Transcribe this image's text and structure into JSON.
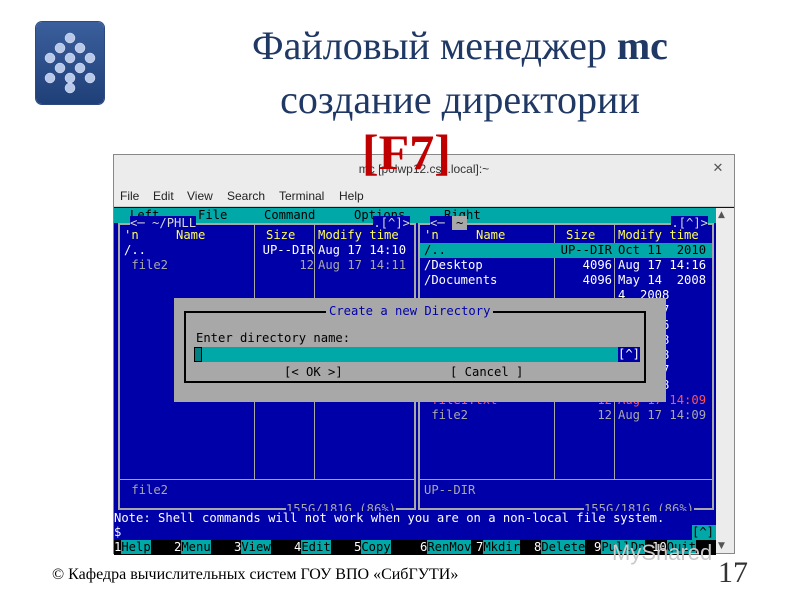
{
  "slide": {
    "title_line1_prefix": "Файловый менеджер ",
    "title_line1_bold": "mc",
    "title_line2": "создание директории",
    "hotkey": "[F7]",
    "footer": "© Кафедра вычислительных систем ГОУ ВПО «СибГУТИ»",
    "page_number": "17",
    "watermark": "MyShared"
  },
  "window": {
    "title": "mc [polwp12.csc.local]:~",
    "close_glyph": "✕",
    "menu": [
      "File",
      "Edit",
      "View",
      "Search",
      "Terminal",
      "Help"
    ]
  },
  "mc_menu": [
    "Left",
    "File",
    "Command",
    "Options",
    "Right"
  ],
  "left_panel": {
    "title": "~/PHLL",
    "corner": ".[^]>",
    "col_n": "'n",
    "col_name": "Name",
    "col_size": "Size",
    "col_mtime": "Modify time",
    "rows": [
      {
        "name": "/..",
        "size": "UP--DIR",
        "mtime": "Aug 17 14:10",
        "style": "wht"
      },
      {
        "name": " file2",
        "size": "12",
        "mtime": "Aug 17 14:11",
        "style": "gry"
      }
    ],
    "status": " file2",
    "free": "155G/181G (86%)"
  },
  "right_panel": {
    "title": "~",
    "corner": ".[^]>",
    "col_n": "'n",
    "col_name": "Name",
    "col_size": "Size",
    "col_mtime": "Modify time",
    "rows": [
      {
        "name": "/..",
        "size": "UP--DIR",
        "mtime": "Oct 11  2010",
        "style": "sel"
      },
      {
        "name": "/Desktop",
        "size": "4096",
        "mtime": "Aug 17 14:16",
        "style": "wht"
      },
      {
        "name": "/Documents",
        "size": "4096",
        "mtime": "May 14  2008",
        "style": "wht"
      },
      {
        "name": "",
        "size": "",
        "mtime": "4  2008",
        "style": "wht"
      },
      {
        "name": "",
        "size": "",
        "mtime": "5 17:17",
        "style": "wht"
      },
      {
        "name": "",
        "size": "",
        "mtime": "7 14:16",
        "style": "wht"
      },
      {
        "name": "",
        "size": "",
        "mtime": "4  2008",
        "style": "wht"
      },
      {
        "name": "",
        "size": "",
        "mtime": "4  2008",
        "style": "wht"
      },
      {
        "name": "",
        "size": "",
        "mtime": "7  2007",
        "style": "wht"
      },
      {
        "name": "",
        "size": "",
        "mtime": "4  2008",
        "style": "wht"
      },
      {
        "name": " file1.txt",
        "size": "12",
        "mtime": "Aug 17 14:09",
        "style": "red"
      },
      {
        "name": " file2",
        "size": "12",
        "mtime": "Aug 17 14:09",
        "style": "gry"
      }
    ],
    "status": "UP--DIR",
    "free": "155G/181G (86%)"
  },
  "dialog": {
    "title": "Create a new Directory",
    "label": "Enter directory name:",
    "input_value": "",
    "history": "[^]",
    "ok": "[< OK >]",
    "cancel": "[ Cancel ]"
  },
  "note": "Note: Shell commands will not work when you are on a non-local file system.",
  "prompt": "$",
  "history_btn": "[^]",
  "fkeys": [
    {
      "num": "1",
      "label": "Help"
    },
    {
      "num": "2",
      "label": "Menu"
    },
    {
      "num": "3",
      "label": "View"
    },
    {
      "num": "4",
      "label": "Edit"
    },
    {
      "num": "5",
      "label": "Copy"
    },
    {
      "num": "6",
      "label": "RenMov"
    },
    {
      "num": "7",
      "label": "Mkdir"
    },
    {
      "num": "8",
      "label": "Delete"
    },
    {
      "num": "9",
      "label": "PullDn"
    },
    {
      "num": "10",
      "label": "Quit"
    }
  ],
  "colors": {
    "mc_blue": "#0000a8",
    "mc_cyan": "#00a8a8",
    "title_blue": "#1f3864",
    "hotkey_red": "#c00000"
  }
}
